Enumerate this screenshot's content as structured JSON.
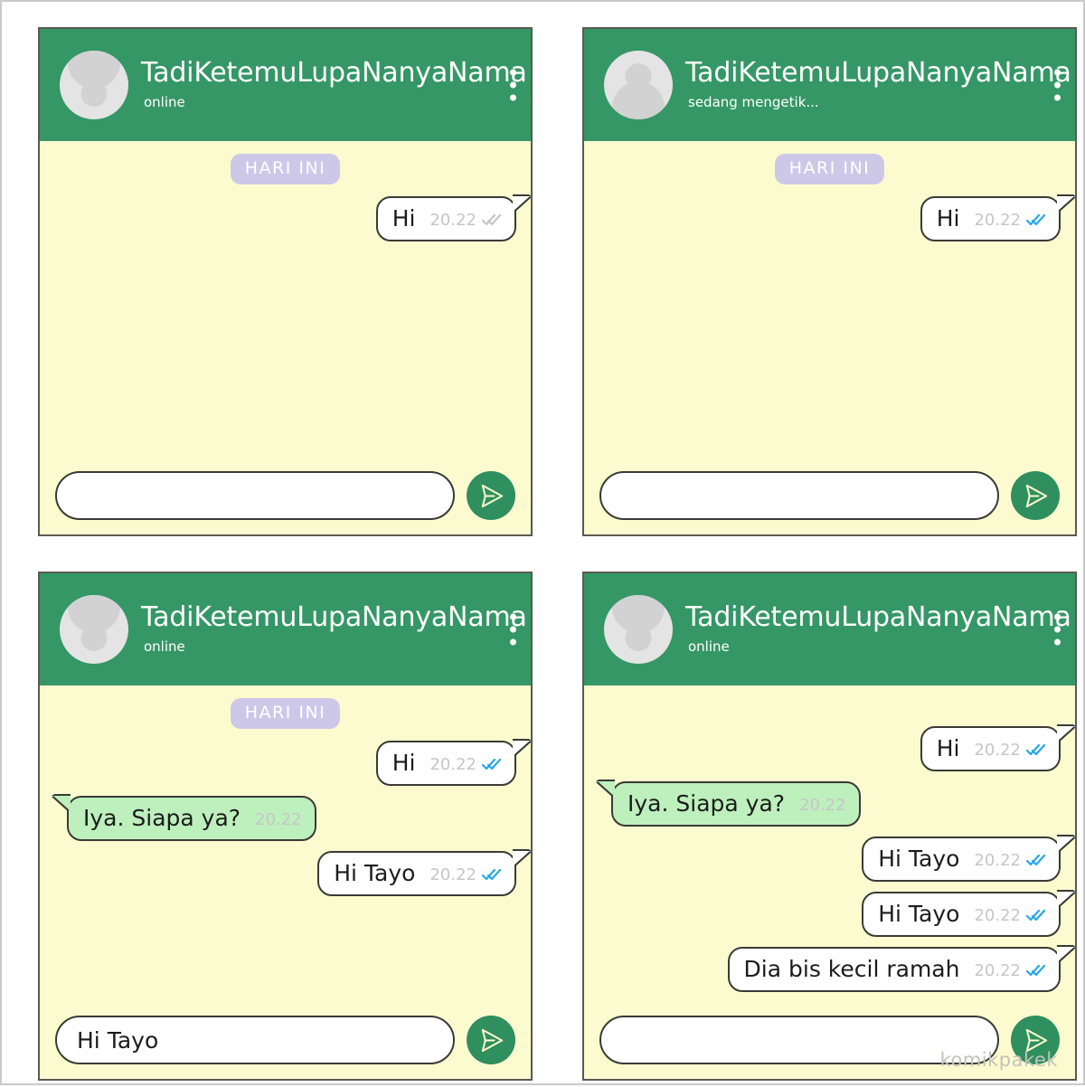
{
  "watermark": "komikpakek",
  "colors": {
    "header_green": "#359766",
    "chat_background": "#fcfbcf",
    "incoming_bubble": "#bdf0bd",
    "outgoing_bubble": "#ffffff",
    "date_badge": "#cdc8e8",
    "tick_read": "#29a7e4",
    "tick_sent": "#c6c6c6",
    "send_button": "#2f8f5e",
    "panel_border": "#5a5a52"
  },
  "contact": {
    "name": "TadiKetemuLupaNanyaNama",
    "status_online": "online",
    "status_typing": "sedang mengetik..."
  },
  "date_badge_label": "HARI INI",
  "panels": [
    {
      "id": "panel-1",
      "status": "online",
      "show_date_badge": true,
      "messages": [
        {
          "text": "Hi",
          "time": "20.22",
          "direction": "out",
          "ticks": "sent"
        }
      ],
      "input_value": ""
    },
    {
      "id": "panel-2",
      "status": "sedang mengetik...",
      "show_date_badge": true,
      "messages": [
        {
          "text": "Hi",
          "time": "20.22",
          "direction": "out",
          "ticks": "read"
        }
      ],
      "input_value": ""
    },
    {
      "id": "panel-3",
      "status": "online",
      "show_date_badge": true,
      "messages": [
        {
          "text": "Hi",
          "time": "20.22",
          "direction": "out",
          "ticks": "read"
        },
        {
          "text": "Iya. Siapa ya?",
          "time": "20.22",
          "direction": "in",
          "ticks": "none"
        },
        {
          "text": "Hi Tayo",
          "time": "20.22",
          "direction": "out",
          "ticks": "read"
        }
      ],
      "input_value": "Hi Tayo"
    },
    {
      "id": "panel-4",
      "status": "online",
      "show_date_badge": false,
      "messages": [
        {
          "text": "Hi",
          "time": "20.22",
          "direction": "out",
          "ticks": "read"
        },
        {
          "text": "Iya. Siapa ya?",
          "time": "20.22",
          "direction": "in",
          "ticks": "none"
        },
        {
          "text": "Hi Tayo",
          "time": "20.22",
          "direction": "out",
          "ticks": "read"
        },
        {
          "text": "Hi Tayo",
          "time": "20.22",
          "direction": "out",
          "ticks": "read"
        },
        {
          "text": "Dia bis kecil ramah",
          "time": "20.22",
          "direction": "out",
          "ticks": "read"
        }
      ],
      "input_value": ""
    }
  ],
  "icons": {
    "menu": "three-dots-vertical-icon",
    "send": "paper-plane-icon",
    "avatar": "person-avatar-icon",
    "ticks": "double-check-icon"
  }
}
